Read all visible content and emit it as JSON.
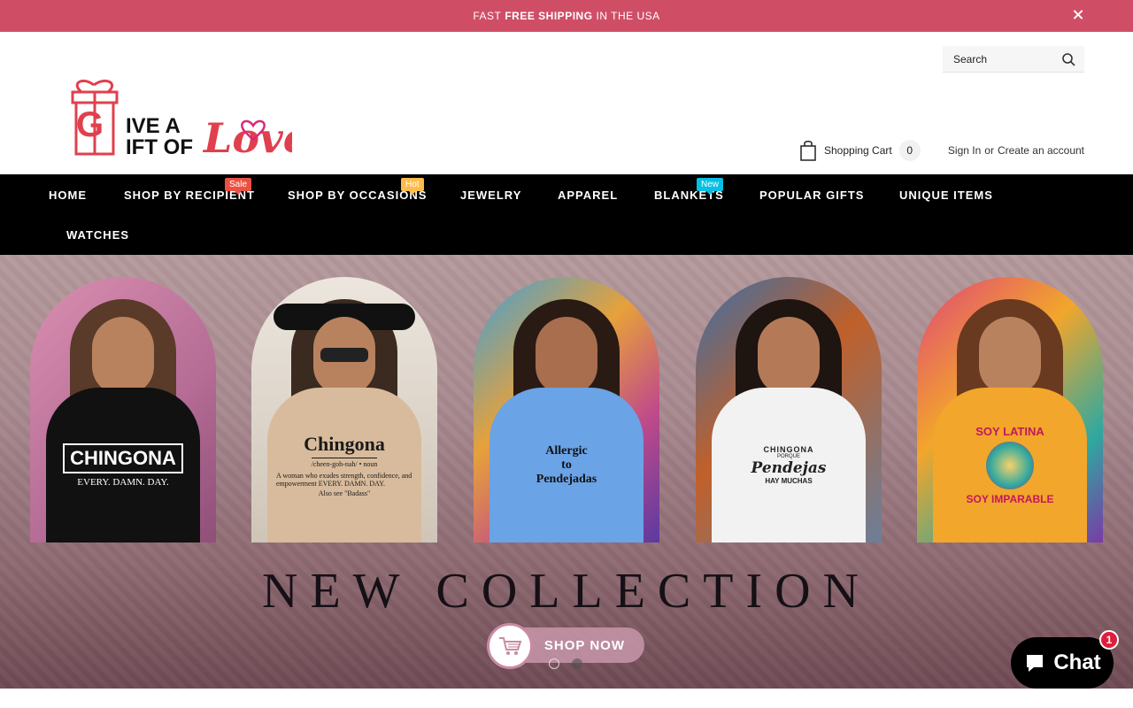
{
  "announcement": {
    "prefix": "FAST",
    "highlight": "FREE SHIPPING",
    "suffix": "IN THE USA"
  },
  "header": {
    "logo_text": "Give a Gift of Love",
    "search": {
      "placeholder": "Search"
    },
    "cart": {
      "label": "Shopping Cart",
      "count": "0"
    },
    "account": {
      "sign_in": "Sign In",
      "or": "or",
      "create": "Create an account"
    }
  },
  "nav": {
    "items": [
      {
        "label": "HOME"
      },
      {
        "label": "SHOP BY RECIPIENT",
        "badge": "Sale"
      },
      {
        "label": "SHOP BY OCCASIONS",
        "badge": "Hot"
      },
      {
        "label": "JEWELRY"
      },
      {
        "label": "APPAREL"
      },
      {
        "label": "BLANKETS",
        "badge": "New"
      },
      {
        "label": "POPULAR GIFTS"
      },
      {
        "label": "UNIQUE ITEMS"
      },
      {
        "label": "WATCHES"
      }
    ]
  },
  "hero": {
    "title": "NEW COLLECTION",
    "button": "SHOP NOW",
    "shirts": [
      {
        "line1": "CHINGONA",
        "line2": "EVERY. DAMN. DAY.",
        "color": "#111111",
        "text": "#ffffff"
      },
      {
        "line1": "Chingona",
        "line2": "/cheen-goh-nah/ • noun",
        "line3": "A woman who exudes strength, confidence, and empowerment EVERY. DAMN. DAY.",
        "line4": "Also see \"Badass\"",
        "color": "#d8bb9c",
        "text": "#1a1a1a"
      },
      {
        "line1": "Allergic",
        "line2": "to",
        "line3": "Pendejadas",
        "color": "#6aa3e6",
        "text": "#111111"
      },
      {
        "line1": "CHINGONA",
        "line2": "PORQUE",
        "line3": "Pendejas",
        "line4": "HAY MUCHAS",
        "color": "#f2f2f2",
        "text": "#222222"
      },
      {
        "line1": "SOY LATINA",
        "line2": "SOY IMPARABLE",
        "color": "#f2a62b",
        "text": "#c2185b"
      }
    ]
  },
  "chat": {
    "label": "Chat",
    "badge": "1"
  },
  "colors": {
    "announcement": "#cf4e66",
    "sale": "#e95144",
    "hot": "#ffbb49",
    "new": "#06bfe2"
  }
}
